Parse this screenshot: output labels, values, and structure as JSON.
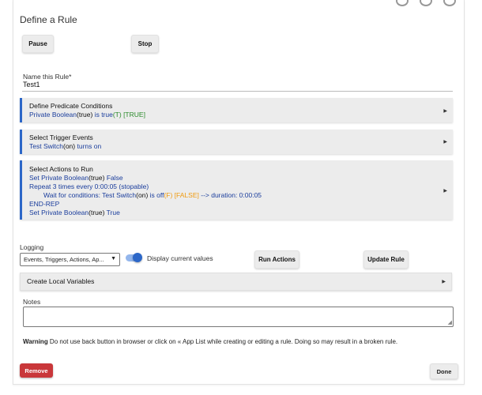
{
  "page_title": "Define a Rule",
  "controls": {
    "pause_label": "Pause",
    "stop_label": "Stop"
  },
  "name_field": {
    "label": "Name this Rule*",
    "value": "Test1"
  },
  "predicate": {
    "title": "Define Predicate Conditions",
    "line_a": "Private Boolean",
    "line_b": "(true)",
    "line_c": " is true",
    "line_d": "(T)",
    "line_e": " [TRUE]"
  },
  "trigger": {
    "title": "Select Trigger Events",
    "line_a": "Test Switch",
    "line_b": "(on)",
    "line_c": " turns on"
  },
  "actions": {
    "title": "Select Actions to Run",
    "l1a": "Set Private Boolean",
    "l1b": "(true)",
    "l1c": " False",
    "l2": "Repeat 3 times every 0:00:05 (stopable)",
    "l3a": "Wait for conditions: Test Switch",
    "l3b": "(on)",
    "l3c": " is off",
    "l3d": "(F)",
    "l3e": " [FALSE]",
    "l3f": "  --> duration: 0:00:05",
    "l4": "END-REP",
    "l5a": "Set Private Boolean",
    "l5b": "(true)",
    "l5c": " True"
  },
  "logging": {
    "label": "Logging",
    "selected": "Events, Triggers, Actions, Ap...",
    "toggle_label": "Display current values",
    "toggle_on": true
  },
  "buttons": {
    "run_actions": "Run Actions",
    "update_rule": "Update Rule",
    "remove": "Remove",
    "done": "Done"
  },
  "local_vars": {
    "title": "Create Local Variables"
  },
  "notes": {
    "label": "Notes",
    "value": ""
  },
  "warning": {
    "strong": "Warning",
    "text": " Do not use back button in browser or click on « App List while creating or editing a rule. Doing so may result in a broken rule."
  },
  "colors": {
    "accent": "#2c67c8",
    "danger": "#c9373a",
    "true_green": "#2a8a2a",
    "false_orange": "#f09a0e",
    "link_blue": "#1a3d9c"
  }
}
